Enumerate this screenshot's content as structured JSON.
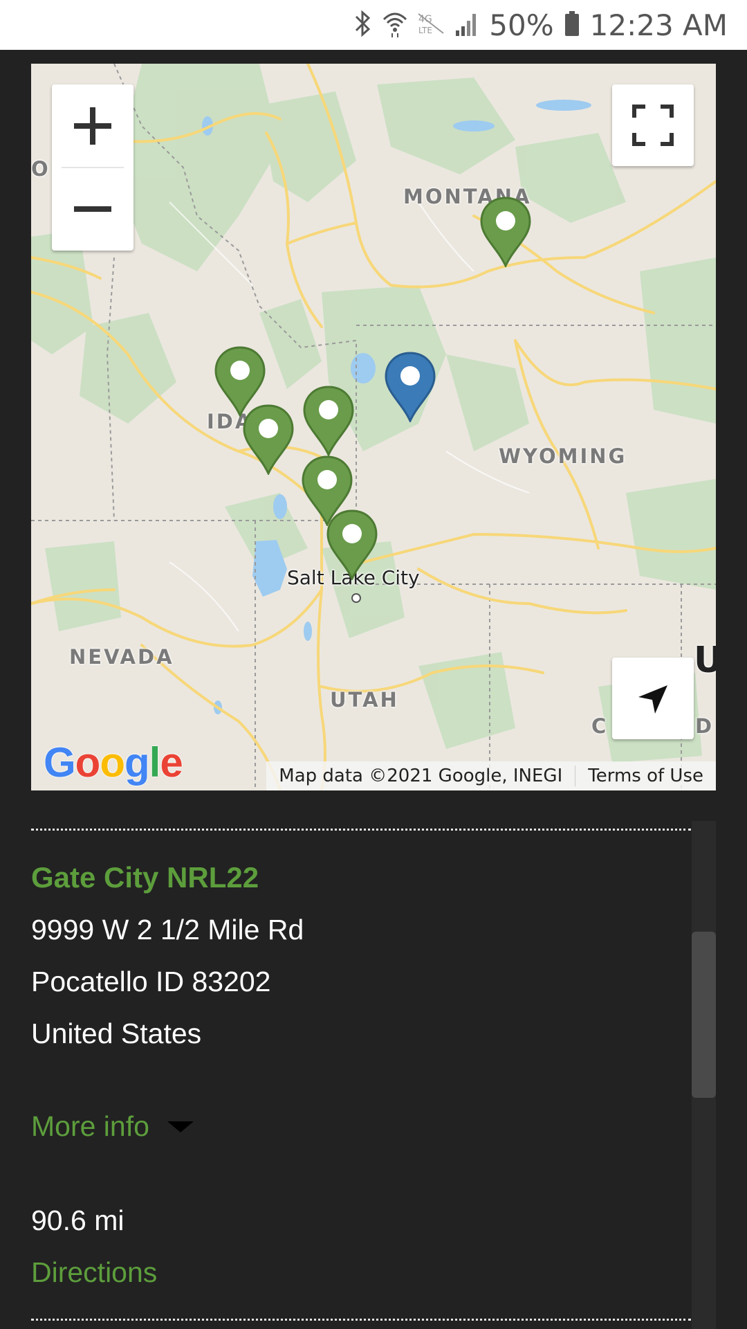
{
  "status_bar": {
    "battery": "50%",
    "time": "12:23 AM",
    "icons": [
      "bluetooth-icon",
      "wifi-icon",
      "lte-icon",
      "signal-icon",
      "battery-icon"
    ]
  },
  "map": {
    "labels": {
      "montana": "MONTANA",
      "idaho": "IDA",
      "wyoming": "WYOMING",
      "nevada": "NEVADA",
      "utah": "UTAH",
      "co_left": "C",
      "co_right": "D",
      "edge_left": "O",
      "edge_u": "U"
    },
    "city": "Salt Lake City",
    "attribution": "Map data ©2021 Google, INEGI",
    "terms": "Terms of Use",
    "logo_letters": [
      "G",
      "o",
      "o",
      "g",
      "l",
      "e"
    ],
    "colors": {
      "pin_green": "#6a9c4b",
      "pin_blue": "#3a7bb8",
      "land": "#ebe7df",
      "park": "#c8dfc0",
      "water": "#9ecbf0",
      "road": "#f7d779"
    }
  },
  "location": {
    "name": "Gate City NRL22",
    "address_line1": "9999 W 2 1/2 Mile Rd",
    "address_line2": "Pocatello ID 83202",
    "country": "United States",
    "more_info": "More info",
    "distance": "90.6 mi",
    "directions": "Directions"
  },
  "accent_color": "#5d9e3c"
}
